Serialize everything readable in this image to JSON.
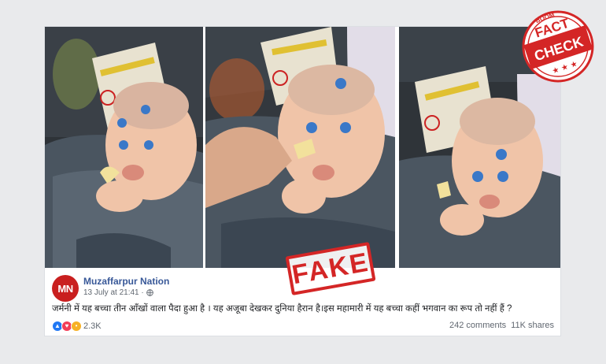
{
  "post": {
    "avatar_initials": "MN",
    "page_name": "Muzaffarpur Nation",
    "timestamp": "13 July at 21:41 ·",
    "text": "जर्मनी में यह बच्चा तीन आँखों वाला पैदा हुआ है । यह अजूबा देखकर दुनिया हैरान है।इस महामारी में यह बच्चा कहीं भगवान का रूप तो नहीं हैं ?",
    "reaction_count": "2.3K",
    "comments": "242 comments",
    "shares": "11K shares"
  },
  "overlay": {
    "fake_stamp": "FAKE",
    "badge_brand": "BOOM",
    "badge_line1": "FACT",
    "badge_line2": "CHECK"
  },
  "colors": {
    "stamp_red": "#d42626",
    "link_blue": "#385898",
    "avatar_red": "#c91f1f"
  },
  "icons": [
    "globe-icon",
    "like-reaction-icon",
    "love-reaction-icon",
    "wow-reaction-icon",
    "star-icon"
  ]
}
